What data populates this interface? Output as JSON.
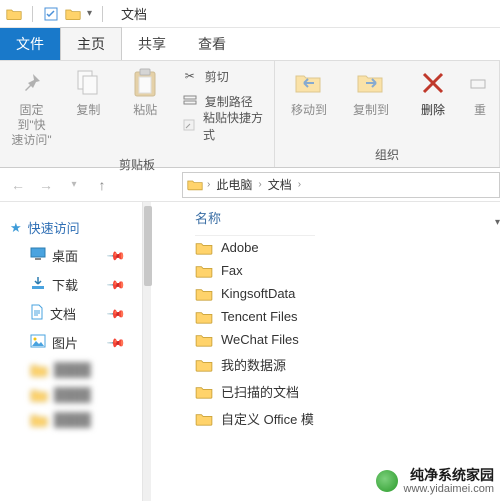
{
  "titlebar": {
    "title": "文档"
  },
  "tabs": {
    "file": "文件",
    "home": "主页",
    "share": "共享",
    "view": "查看"
  },
  "ribbon": {
    "pin": {
      "line1": "固定到\"快",
      "line2": "速访问\""
    },
    "copy": "复制",
    "paste": "粘贴",
    "cut": "剪切",
    "copy_path": "复制路径",
    "paste_shortcut": "粘贴快捷方式",
    "clipboard_group": "剪贴板",
    "move_to": "移动到",
    "copy_to": "复制到",
    "delete": "删除",
    "rename_partial": "重",
    "organize_group": "组织"
  },
  "nav": {
    "this_pc": "此电脑",
    "documents": "文档"
  },
  "sidebar": {
    "quick_access": "快速访问",
    "items": [
      {
        "label": "桌面",
        "icon": "desktop",
        "pinned": true
      },
      {
        "label": "下载",
        "icon": "downloads",
        "pinned": true
      },
      {
        "label": "文档",
        "icon": "documents",
        "pinned": true
      },
      {
        "label": "图片",
        "icon": "pictures",
        "pinned": true
      }
    ],
    "blurred_count": 3
  },
  "columns": {
    "name": "名称"
  },
  "files": [
    {
      "name": "Adobe"
    },
    {
      "name": "Fax"
    },
    {
      "name": "KingsoftData"
    },
    {
      "name": "Tencent Files"
    },
    {
      "name": "WeChat Files"
    },
    {
      "name": "我的数据源"
    },
    {
      "name": "已扫描的文档"
    },
    {
      "name": "自定义 Office 模"
    }
  ],
  "watermark": {
    "cn": "纯净系统家园",
    "url": "www.yidaimei.com"
  }
}
